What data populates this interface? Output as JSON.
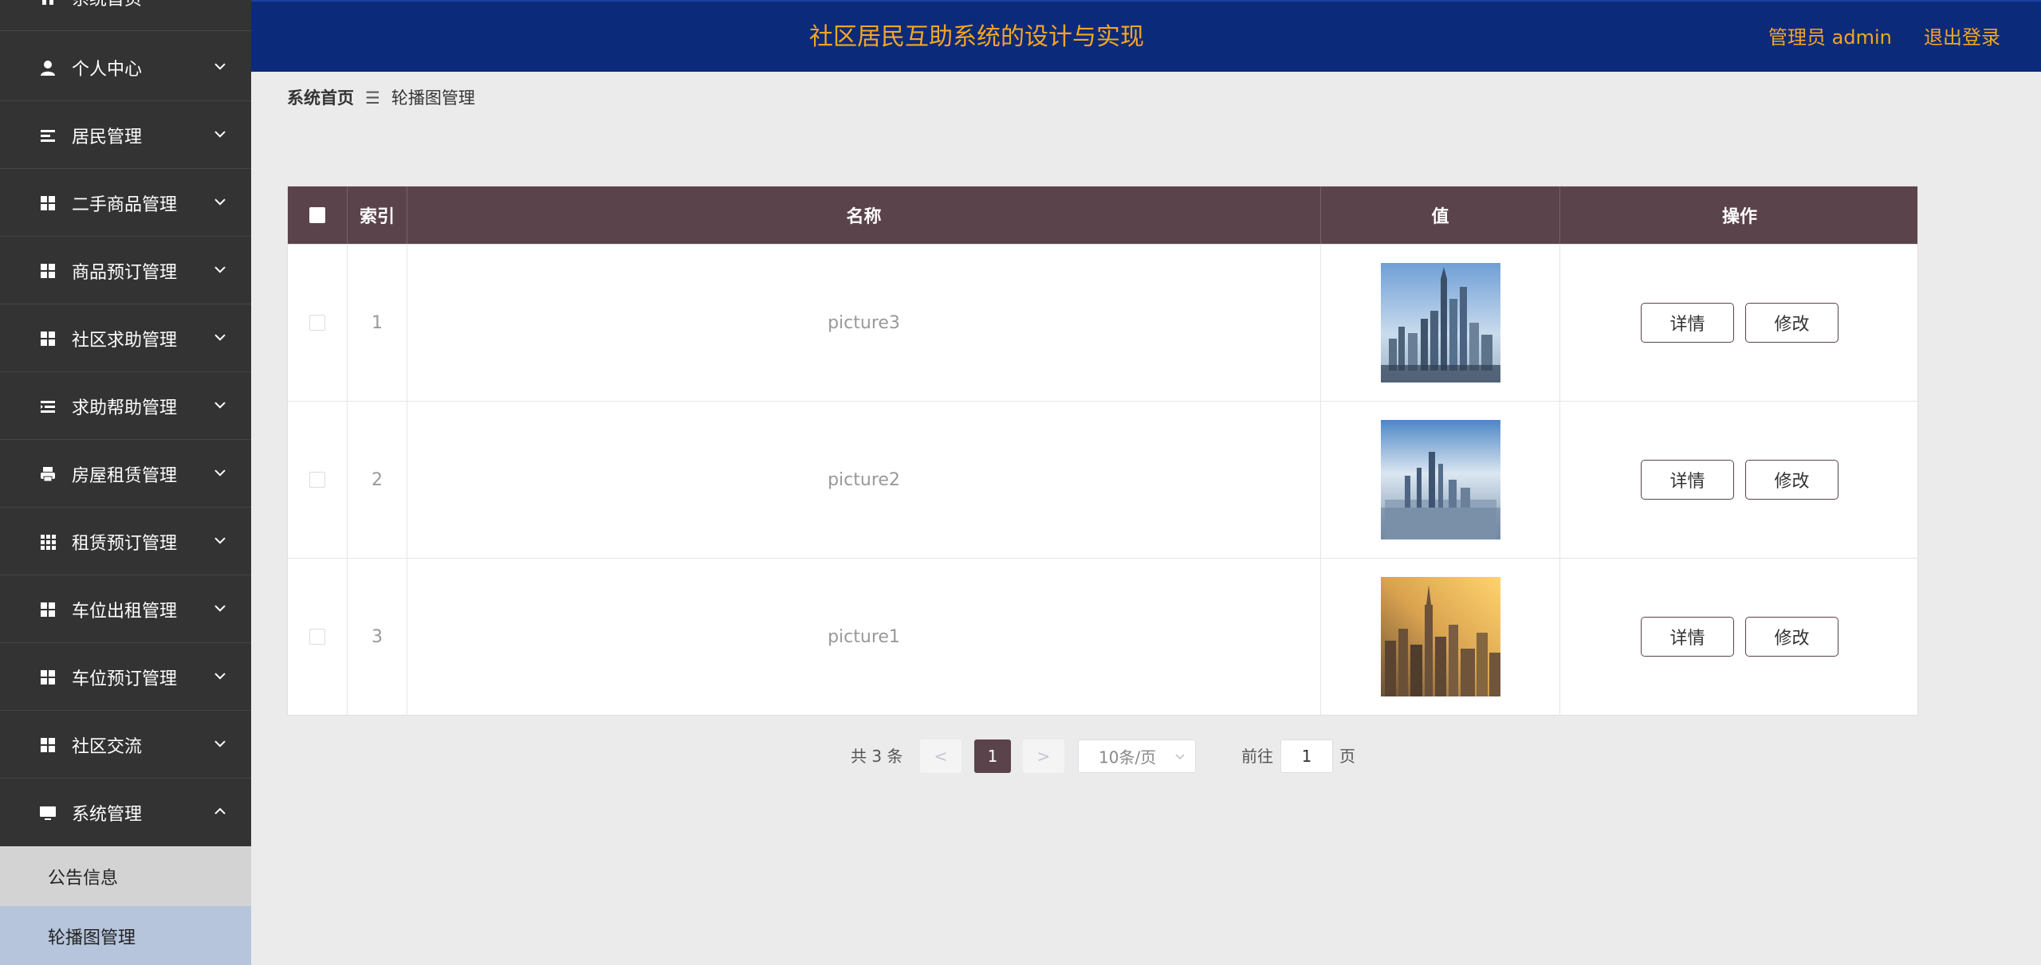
{
  "header": {
    "title": "社区居民互助系统的设计与实现",
    "admin_label": "管理员 admin",
    "logout_label": "退出登录"
  },
  "sidebar": {
    "items": [
      {
        "label": "系统首页",
        "icon": "home-icon"
      },
      {
        "label": "个人中心",
        "icon": "user-icon"
      },
      {
        "label": "居民管理",
        "icon": "list-icon"
      },
      {
        "label": "二手商品管理",
        "icon": "grid-icon"
      },
      {
        "label": "商品预订管理",
        "icon": "grid-icon"
      },
      {
        "label": "社区求助管理",
        "icon": "grid-icon"
      },
      {
        "label": "求助帮助管理",
        "icon": "list-indent-icon"
      },
      {
        "label": "房屋租赁管理",
        "icon": "printer-icon"
      },
      {
        "label": "租赁预订管理",
        "icon": "apps-icon"
      },
      {
        "label": "车位出租管理",
        "icon": "grid-icon"
      },
      {
        "label": "车位预订管理",
        "icon": "grid-icon"
      },
      {
        "label": "社区交流",
        "icon": "grid-icon"
      },
      {
        "label": "系统管理",
        "icon": "monitor-icon",
        "expanded": true
      }
    ],
    "sub_items": [
      {
        "label": "公告信息"
      },
      {
        "label": "轮播图管理",
        "active": true
      }
    ]
  },
  "breadcrumb": {
    "home": "系统首页",
    "separator": "☰",
    "current": "轮播图管理"
  },
  "table": {
    "headers": {
      "index": "索引",
      "name": "名称",
      "value": "值",
      "actions": "操作"
    },
    "rows": [
      {
        "index": "1",
        "name": "picture3"
      },
      {
        "index": "2",
        "name": "picture2"
      },
      {
        "index": "3",
        "name": "picture1"
      }
    ],
    "detail_label": "详情",
    "edit_label": "修改"
  },
  "pagination": {
    "total": "共 3 条",
    "prev": "<",
    "next": ">",
    "current_page": "1",
    "page_size": "10条/页",
    "goto_label": "前往",
    "goto_value": "1",
    "page_suffix": "页"
  },
  "colors": {
    "sidebar_bg": "#333333",
    "header_bg": "#0b2a7a",
    "accent": "#f5a623",
    "table_header": "#5b434b",
    "sub_menu_bg": "#d3d3d3",
    "sub_menu_active_bg": "#b6c5dc"
  }
}
